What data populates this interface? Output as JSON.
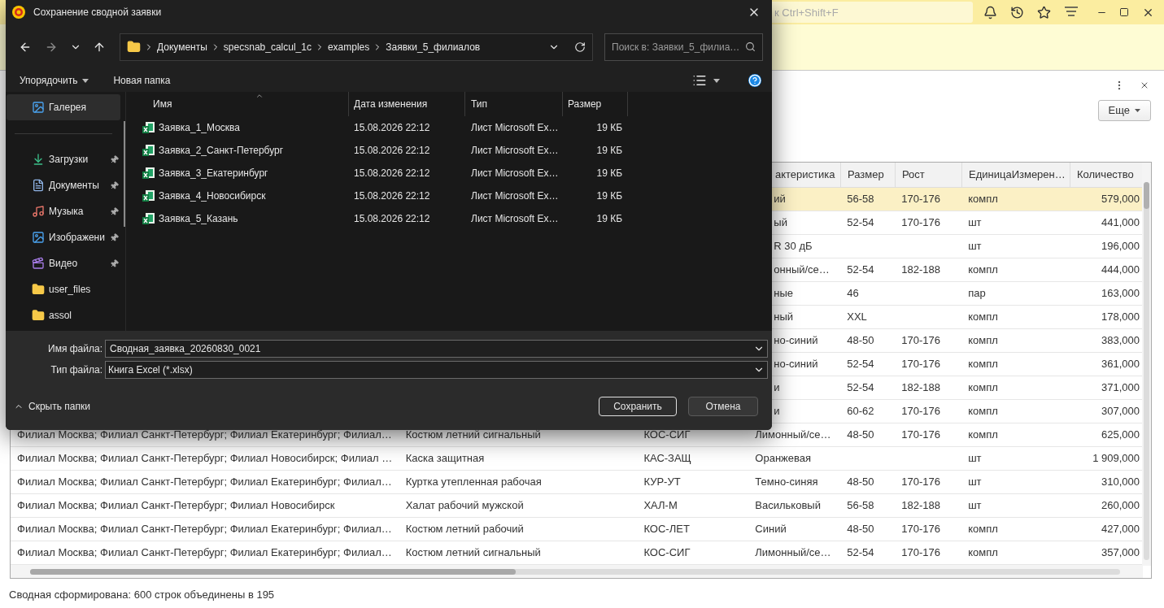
{
  "search": {
    "placeholder": "к Ctrl+Shift+F"
  },
  "more_button": "Еще",
  "table": {
    "headers": [
      "актеристика",
      "Размер",
      "Рост",
      "ЕдиницаИзмерен…",
      "Количество"
    ],
    "rows": [
      {
        "selected": true,
        "characteristic": "ий",
        "size": "56-58",
        "growth": "170-176",
        "unit": "компл",
        "quantity": "579,000"
      },
      {
        "selected": false,
        "characteristic": "ый",
        "size": "52-54",
        "growth": "170-176",
        "unit": "шт",
        "quantity": "441,000"
      },
      {
        "selected": false,
        "characteristic": "R 30 дБ",
        "unit": "шт",
        "quantity": "196,000"
      },
      {
        "selected": false,
        "characteristic": "онный/се…",
        "size": "52-54",
        "growth": "182-188",
        "unit": "компл",
        "quantity": "444,000"
      },
      {
        "selected": false,
        "characteristic": "ные",
        "size": "46",
        "unit": "пар",
        "quantity": "163,000"
      },
      {
        "selected": false,
        "characteristic": "ный",
        "size": "XXL",
        "unit": "компл",
        "quantity": "178,000"
      },
      {
        "selected": false,
        "characteristic": "но-синий",
        "size": "48-50",
        "growth": "170-176",
        "unit": "компл",
        "quantity": "383,000"
      },
      {
        "selected": false,
        "characteristic": "но-синий",
        "size": "52-54",
        "growth": "170-176",
        "unit": "компл",
        "quantity": "361,000"
      },
      {
        "selected": false,
        "characteristic": "и",
        "size": "52-54",
        "growth": "182-188",
        "unit": "компл",
        "quantity": "371,000"
      },
      {
        "selected": false,
        "characteristic": "и",
        "size": "60-62",
        "growth": "170-176",
        "unit": "компл",
        "quantity": "307,000"
      },
      {
        "selected": false,
        "branches": "Филиал Москва; Филиал Санкт-Петербург; Филиал Екатеринбург; Филиал…",
        "item": "Костюм летний сигнальный",
        "article": "КОС-СИГ",
        "characteristic": "Лимонный/се…",
        "size": "48-50",
        "growth": "170-176",
        "unit": "компл",
        "quantity": "625,000"
      },
      {
        "selected": false,
        "branches": "Филиал Москва; Филиал Санкт-Петербург; Филиал Новосибирск; Филиал …",
        "item": "Каска защитная",
        "article": "КАС-ЗАЩ",
        "characteristic": "Оранжевая",
        "unit": "шт",
        "quantity": "1 909,000"
      },
      {
        "selected": false,
        "branches": "Филиал Москва; Филиал Санкт-Петербург; Филиал Екатеринбург; Филиал…",
        "item": "Куртка утепленная рабочая",
        "article": "КУР-УТ",
        "characteristic": "Темно-синяя",
        "size": "48-50",
        "growth": "170-176",
        "unit": "шт",
        "quantity": "310,000"
      },
      {
        "selected": false,
        "branches": "Филиал Москва; Филиал Санкт-Петербург; Филиал Новосибирск",
        "item": "Халат рабочий мужской",
        "article": "ХАЛ-М",
        "characteristic": "Васильковый",
        "size": "56-58",
        "growth": "182-188",
        "unit": "шт",
        "quantity": "260,000"
      },
      {
        "selected": false,
        "branches": "Филиал Москва; Филиал Санкт-Петербург; Филиал Екатеринбург; Филиал…",
        "item": "Костюм летний рабочий",
        "article": "КОС-ЛЕТ",
        "characteristic": "Синий",
        "size": "48-50",
        "growth": "170-176",
        "unit": "компл",
        "quantity": "427,000"
      },
      {
        "selected": false,
        "branches": "Филиал Москва; Филиал Санкт-Петербург; Филиал Екатеринбург; Филиал…",
        "item": "Костюм летний сигнальный",
        "article": "КОС-СИГ",
        "characteristic": "Лимонный/се…",
        "size": "52-54",
        "growth": "170-176",
        "unit": "компл",
        "quantity": "357,000"
      }
    ]
  },
  "status": "Сводная сформирована: 600 строк объединены в 195",
  "dialog": {
    "title": "Сохранение сводной заявки",
    "path": [
      "Документы",
      "specsnab_calcul_1c",
      "examples",
      "Заявки_5_филиалов"
    ],
    "search_placeholder": "Поиск в: Заявки_5_филиа…",
    "sort_button": "Упорядочить",
    "new_folder_button": "Новая папка",
    "sidebar": [
      {
        "label": "Галерея",
        "kind": "gallery",
        "selected": true,
        "pinned": false
      },
      {
        "label": "Загрузки",
        "kind": "downloads",
        "selected": false,
        "pinned": true
      },
      {
        "label": "Документы",
        "kind": "documents",
        "selected": false,
        "pinned": true
      },
      {
        "label": "Музыка",
        "kind": "music",
        "selected": false,
        "pinned": true
      },
      {
        "label": "Изображени",
        "kind": "pictures",
        "selected": false,
        "pinned": true
      },
      {
        "label": "Видео",
        "kind": "video",
        "selected": false,
        "pinned": true
      },
      {
        "label": "user_files",
        "kind": "folder",
        "selected": false,
        "pinned": false
      },
      {
        "label": "assol",
        "kind": "folder",
        "selected": false,
        "pinned": false
      }
    ],
    "columns": [
      "Имя",
      "Дата изменения",
      "Тип",
      "Размер"
    ],
    "files": [
      {
        "name": "Заявка_1_Москва",
        "date": "15.08.2026 22:12",
        "type": "Лист Microsoft Ex…",
        "size": "19 КБ"
      },
      {
        "name": "Заявка_2_Санкт-Петербург",
        "date": "15.08.2026 22:12",
        "type": "Лист Microsoft Ex…",
        "size": "19 КБ"
      },
      {
        "name": "Заявка_3_Екатеринбург",
        "date": "15.08.2026 22:12",
        "type": "Лист Microsoft Ex…",
        "size": "19 КБ"
      },
      {
        "name": "Заявка_4_Новосибирск",
        "date": "15.08.2026 22:12",
        "type": "Лист Microsoft Ex…",
        "size": "19 КБ"
      },
      {
        "name": "Заявка_5_Казань",
        "date": "15.08.2026 22:12",
        "type": "Лист Microsoft Ex…",
        "size": "19 КБ"
      }
    ],
    "filename_label": "Имя файла:",
    "filename": "Сводная_заявка_20260830_0021",
    "filetype_label": "Тип файла:",
    "filetype": "Книга Excel (*.xlsx)",
    "hide_folders": "Скрыть папки",
    "save_button": "Сохранить",
    "cancel_button": "Отмена"
  }
}
